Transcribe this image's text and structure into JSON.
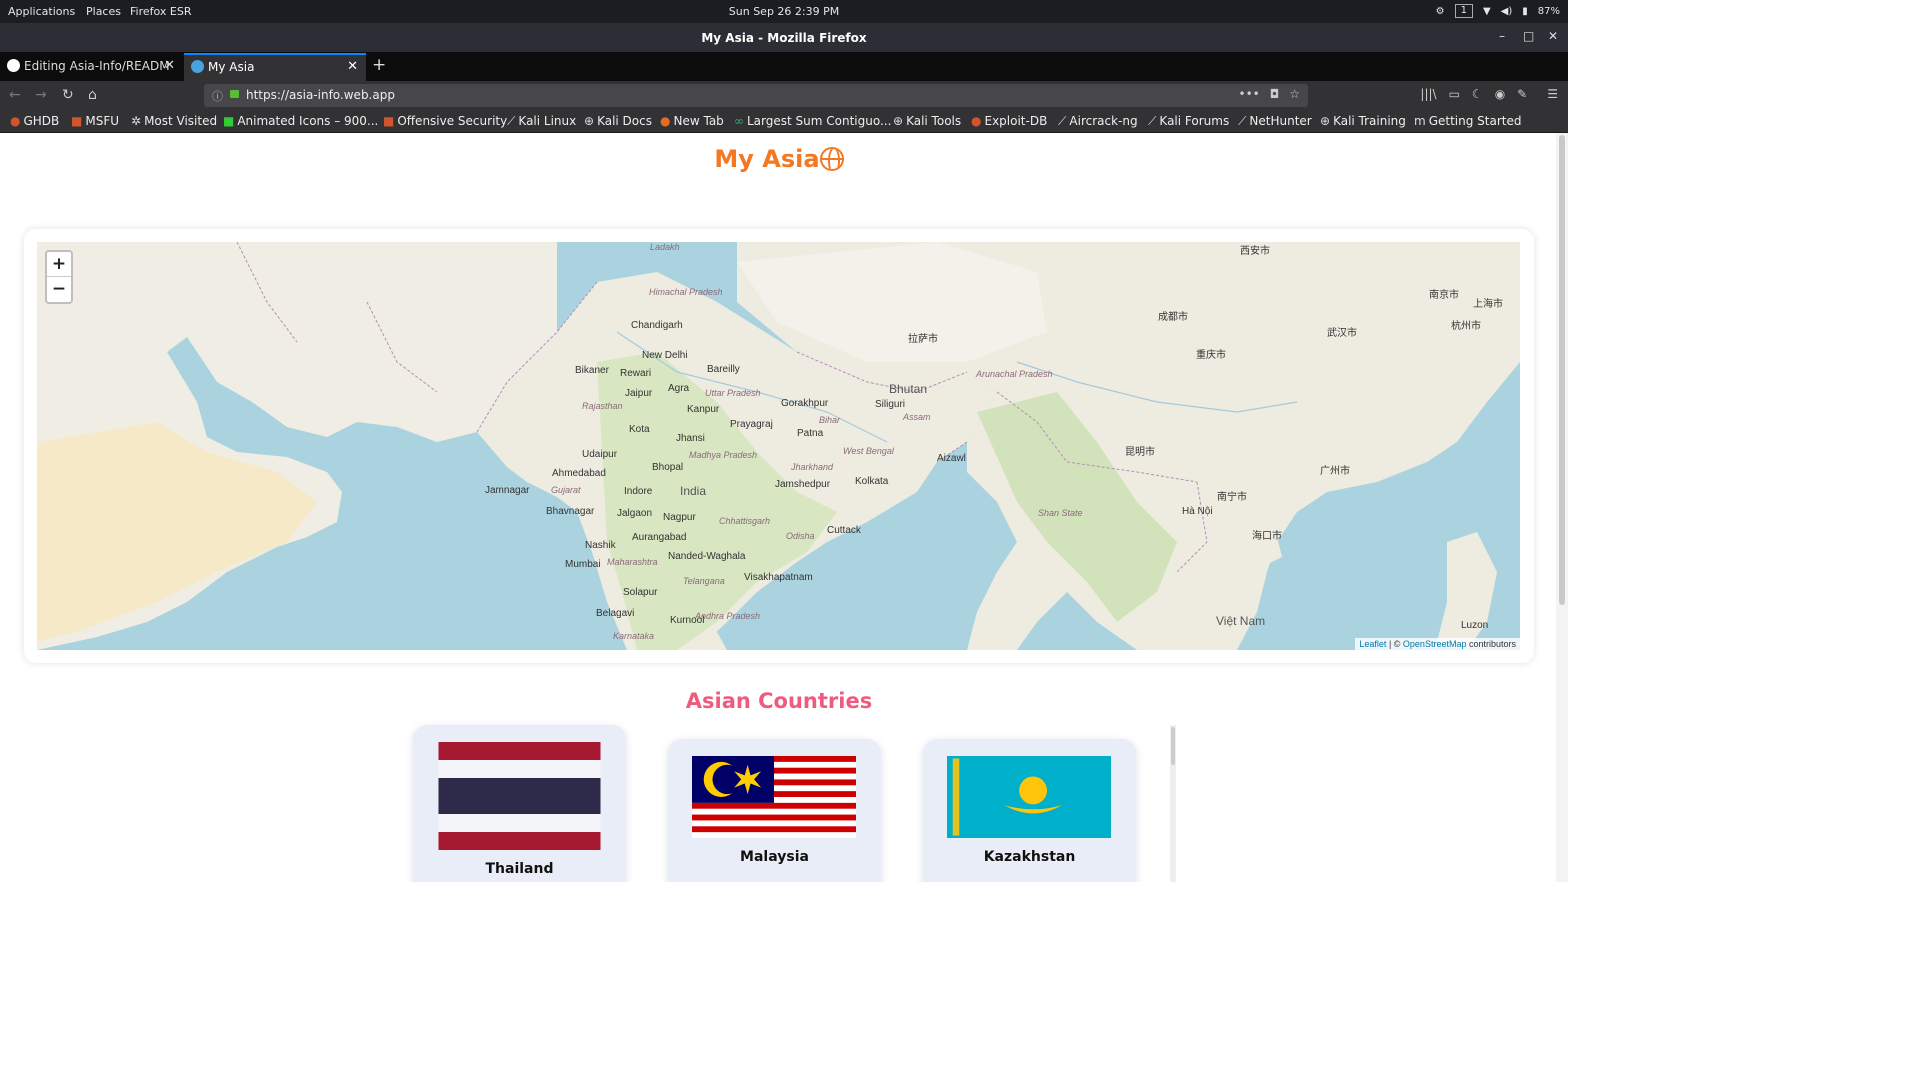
{
  "os_bar": {
    "applications": "Applications",
    "places": "Places",
    "app": "Firefox ESR",
    "clock": "Sun Sep 26   2:39 PM",
    "workspace": "1",
    "battery": "87%"
  },
  "window": {
    "title": "My Asia - Mozilla Firefox"
  },
  "tabs": [
    {
      "label": "Editing Asia-Info/READM"
    },
    {
      "label": "My Asia"
    }
  ],
  "url": "https://asia-info.web.app",
  "bookmarks": [
    "GHDB",
    "MSFU",
    "Most Visited",
    "Animated Icons – 900...",
    "Offensive Security",
    "Kali Linux",
    "Kali Docs",
    "New Tab",
    "Largest Sum Contiguo...",
    "Kali Tools",
    "Exploit-DB",
    "Aircrack-ng",
    "Kali Forums",
    "NetHunter",
    "Kali Training",
    "Getting Started"
  ],
  "page": {
    "title": "My Asia",
    "section_title": "Asian Countries",
    "map": {
      "zoom_in": "+",
      "zoom_out": "−",
      "attribution_leaflet": "Leaflet",
      "attribution_sep": " | © ",
      "attribution_osm": "OpenStreetMap",
      "attribution_tail": " contributors",
      "labels": {
        "india": "India",
        "new_delhi": "New Delhi",
        "chandigarh": "Chandigarh",
        "bikaner": "Bikaner",
        "jaipur": "Jaipur",
        "agra": "Agra",
        "bareilly": "Bareilly",
        "kanpur": "Kanpur",
        "gorakhpur": "Gorakhpur",
        "prayagraj": "Prayagraj",
        "patna": "Patna",
        "siliguri": "Siliguri",
        "bhutan": "Bhutan",
        "kota": "Kota",
        "jhansi": "Jhansi",
        "udaipur": "Udaipur",
        "ahmedabad": "Ahmedabad",
        "bhopal": "Bhopal",
        "jamnagar": "Jamnagar",
        "indore": "Indore",
        "jamshedpur": "Jamshedpur",
        "kolkata": "Kolkata",
        "aizawl": "Aizawl",
        "bhavnagar": "Bhavnagar",
        "jalgaon": "Jalgaon",
        "nagpur": "Nagpur",
        "cuttack": "Cuttack",
        "nashik": "Nashik",
        "aurangabad": "Aurangabad",
        "mumbai": "Mumbai",
        "nanded": "Nanded-Waghala",
        "visakhapatnam": "Visakhapatnam",
        "solapur": "Solapur",
        "belagavi": "Belagavi",
        "kurnool": "Kurnool",
        "hanoi": "Hà Nội",
        "vietnam": "Việt Nam",
        "rewari": "Rewari",
        "gujarat": "Gujarat",
        "rajasthan": "Rajasthan",
        "uttar_pradesh": "Uttar Pradesh",
        "madhya_pradesh": "Madhya Pradesh",
        "maharashtra": "Maharashtra",
        "telangana": "Telangana",
        "andhra": "Andhra Pradesh",
        "karnataka": "Karnataka",
        "chhattisgarh": "Chhattisgarh",
        "odisha": "Odisha",
        "jharkhand": "Jharkhand",
        "bihar": "Bihar",
        "west_bengal": "West Bengal",
        "assam": "Assam",
        "arunachal": "Arunachal Pradesh",
        "ladakh": "Ladakh",
        "himachal": "Himachal Pradesh",
        "shan": "Shan State",
        "luzon": "Luzon",
        "chengdu": "成都市",
        "chongqing": "重庆市",
        "kunming": "昆明市",
        "wuhan": "武汉市",
        "nanning": "南宁市",
        "guangzhou": "广州市",
        "xian": "西安市",
        "lhasa": "拉萨市",
        "haikou": "海口市",
        "nanjing": "南京市",
        "shanghai": "上海市",
        "hangzhou": "杭州市"
      }
    },
    "countries": [
      {
        "name": "Thailand"
      },
      {
        "name": "Malaysia"
      },
      {
        "name": "Kazakhstan"
      }
    ]
  },
  "colors": {
    "title_orange": "#f47721",
    "section_pink": "#ef5b7f",
    "card_bg": "#e9edf7",
    "sea": "#aad3df"
  }
}
